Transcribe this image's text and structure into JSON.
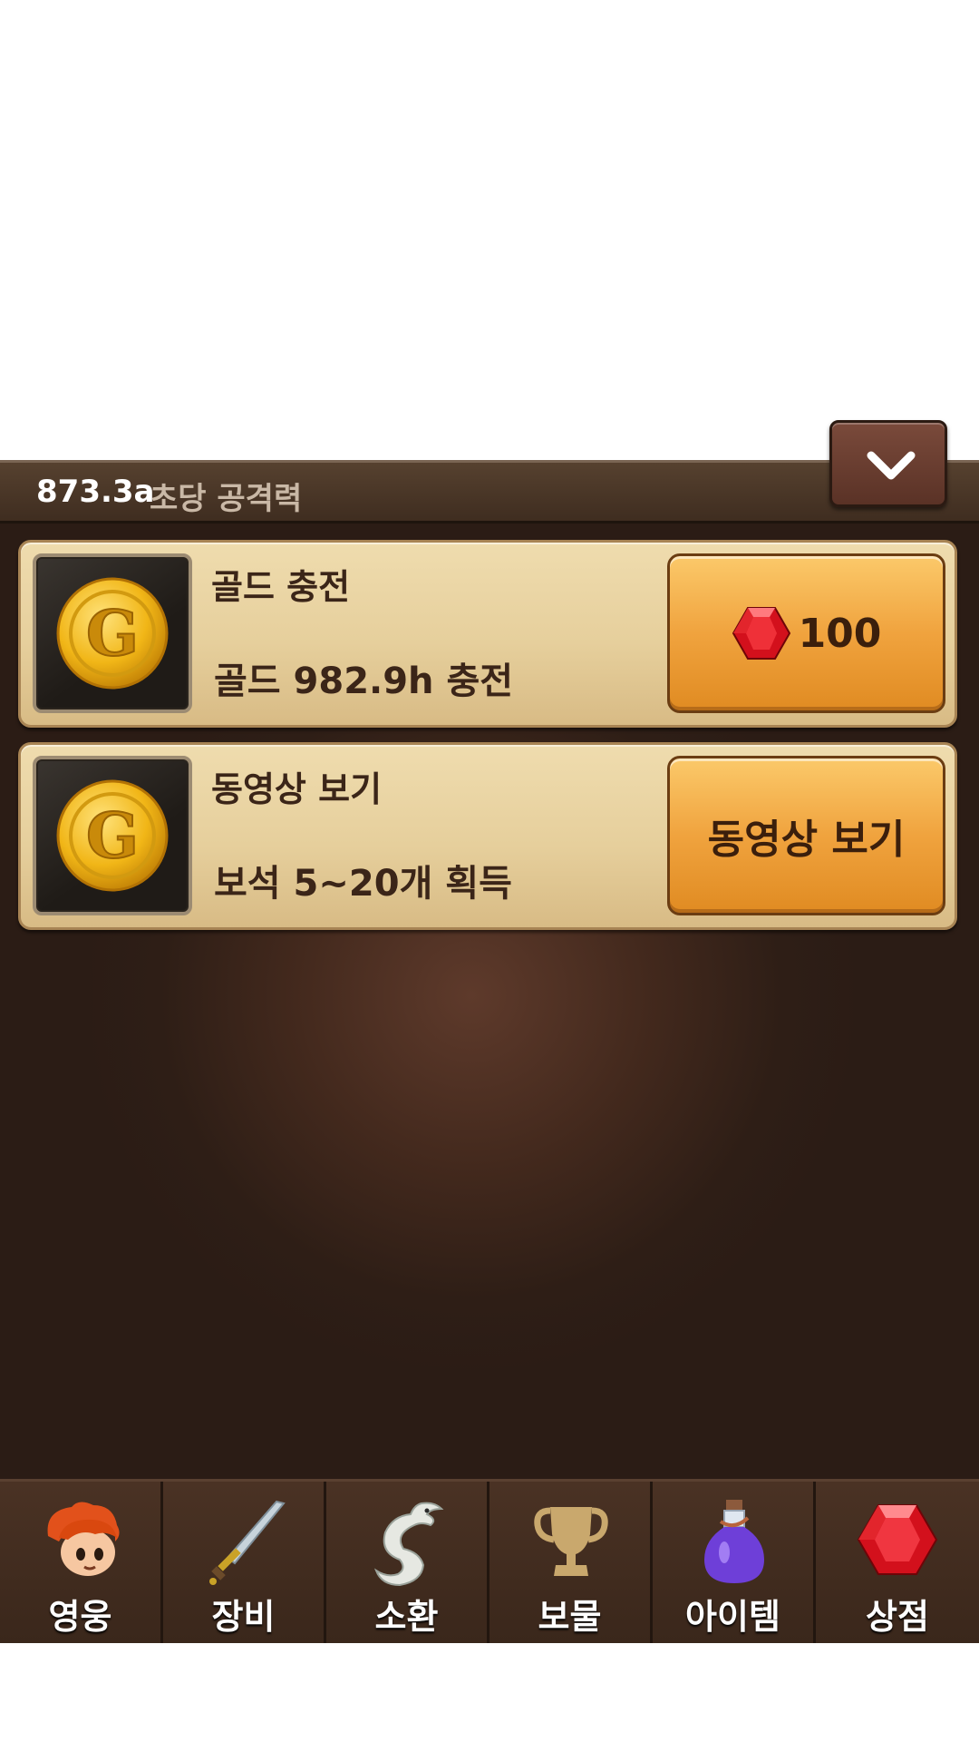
{
  "header": {
    "collapse_icon": "chevron-down-icon",
    "dps_value": "873.3a",
    "dps_label": "초당 공격력"
  },
  "shop_items": [
    {
      "icon": "gold-coin-icon",
      "title": "골드 충전",
      "description": "골드 982.9h 충전",
      "button_icon": "red-gem-icon",
      "button_label": "100"
    },
    {
      "icon": "gold-coin-icon",
      "title": "동영상 보기",
      "description": "보석 5~20개 획득",
      "button_label": "동영상 보기"
    }
  ],
  "tabs": [
    {
      "label": "영웅",
      "icon": "hero-icon"
    },
    {
      "label": "장비",
      "icon": "sword-icon"
    },
    {
      "label": "소환",
      "icon": "dragon-icon"
    },
    {
      "label": "보물",
      "icon": "trophy-icon"
    },
    {
      "label": "아이템",
      "icon": "potion-icon"
    },
    {
      "label": "상점",
      "icon": "gem-icon"
    }
  ],
  "colors": {
    "panel_bg": "#2e1e16",
    "card_bg": "#e6cf9c",
    "button_orange": "#f0a33e",
    "gem_red": "#d3101c",
    "coin_gold": "#f1b617"
  }
}
